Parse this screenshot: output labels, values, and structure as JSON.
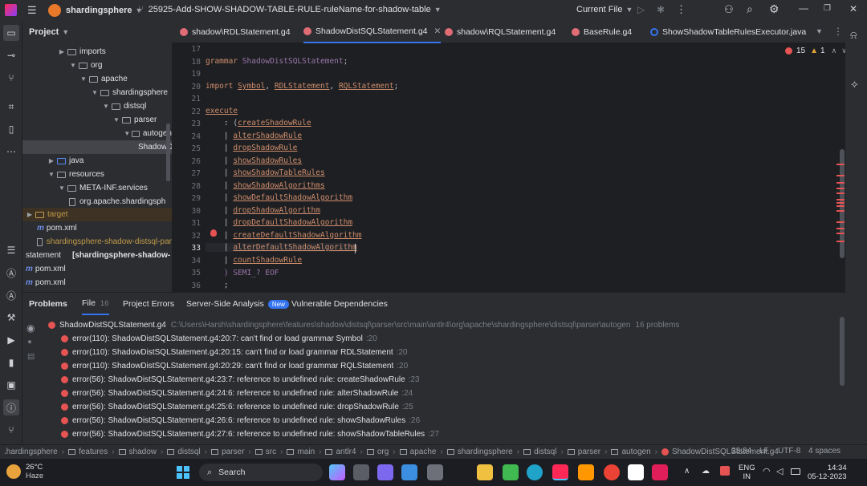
{
  "titlebar": {
    "project": "shardingsphere",
    "branch": "25925-Add-SHOW-SHADOW-TABLE-RULE-ruleName-for-shadow-table",
    "run_config": "Current File"
  },
  "project_panel": {
    "title": "Project",
    "tree": [
      {
        "label": "imports",
        "kind": "folder"
      },
      {
        "label": "org",
        "kind": "folder"
      },
      {
        "label": "apache",
        "kind": "folder"
      },
      {
        "label": "shardingsphere",
        "kind": "folder"
      },
      {
        "label": "distsql",
        "kind": "folder"
      },
      {
        "label": "parser",
        "kind": "folder"
      },
      {
        "label": "autogen",
        "kind": "folder"
      },
      {
        "label": "ShadowD",
        "kind": "file"
      },
      {
        "label": "java",
        "kind": "folder"
      },
      {
        "label": "resources",
        "kind": "folder"
      },
      {
        "label": "META-INF.services",
        "kind": "folder"
      },
      {
        "label": "org.apache.shardingsph",
        "kind": "file"
      },
      {
        "label": "target",
        "kind": "folder"
      },
      {
        "label": "pom.xml",
        "kind": "file"
      },
      {
        "label": "shardingsphere-shadow-distsql-par",
        "kind": "file"
      },
      {
        "label": "statement",
        "kind": "module"
      },
      {
        "label": "[shardingsphere-shadow-",
        "kind": "module"
      },
      {
        "label": "pom.xml",
        "kind": "file"
      },
      {
        "label": "pom.xml",
        "kind": "file"
      }
    ]
  },
  "tabs": [
    {
      "label": "shadow\\RDLStatement.g4",
      "active": false
    },
    {
      "label": "ShadowDistSQLStatement.g4",
      "active": true
    },
    {
      "label": "shadow\\RQLStatement.g4",
      "active": false
    },
    {
      "label": "BaseRule.g4",
      "active": false
    },
    {
      "label": "ShowShadowTableRulesExecutor.java",
      "active": false
    }
  ],
  "editor": {
    "error_count": "15",
    "warning_count": "1",
    "line_numbers": [
      "17",
      "18",
      "19",
      "20",
      "21",
      "22",
      "23",
      "24",
      "25",
      "26",
      "27",
      "28",
      "29",
      "30",
      "31",
      "32",
      "33",
      "34",
      "35",
      "36"
    ],
    "grammar_kw": "grammar",
    "grammar_name": "ShadowDistSQLStatement",
    "import_kw": "import",
    "imports": [
      "Symbol",
      "RDLStatement",
      "RQLStatement"
    ],
    "execute_kw": "execute",
    "rules": [
      "createShadowRule",
      "alterShadowRule",
      "dropShadowRule",
      "showShadowRules",
      "showShadowTableRules",
      "showShadowAlgorithms",
      "showDefaultShadowAlgorithm",
      "dropShadowAlgorithm",
      "dropDefaultShadowAlgorithm",
      "createDefaultShadowAlgorithm",
      "alterDefaultShadowAlgorithm",
      "countShadowRule"
    ],
    "end_line": ") SEMI_? EOF",
    "last_line": ";"
  },
  "problems": {
    "tabs": [
      {
        "label": "Problems"
      },
      {
        "label": "File",
        "count": "16"
      },
      {
        "label": "Project Errors"
      },
      {
        "label": "Server-Side Analysis",
        "badge": "New"
      },
      {
        "label": "Vulnerable Dependencies"
      }
    ],
    "file": "ShadowDistSQLStatement.g4",
    "path": "C:\\Users\\Harsh\\shardingsphere\\features\\shadow\\distsql\\parser\\src\\main\\antlr4\\org\\apache\\shardingsphere\\distsql\\parser\\autogen",
    "count_text": "16 problems",
    "items": [
      {
        "text": "error(110): ShadowDistSQLStatement.g4:20:7: can't find or load grammar Symbol",
        "line": ":20"
      },
      {
        "text": "error(110): ShadowDistSQLStatement.g4:20:15: can't find or load grammar RDLStatement",
        "line": ":20"
      },
      {
        "text": "error(110): ShadowDistSQLStatement.g4:20:29: can't find or load grammar RQLStatement",
        "line": ":20"
      },
      {
        "text": "error(56): ShadowDistSQLStatement.g4:23:7: reference to undefined rule: createShadowRule",
        "line": ":23"
      },
      {
        "text": "error(56): ShadowDistSQLStatement.g4:24:6: reference to undefined rule: alterShadowRule",
        "line": ":24"
      },
      {
        "text": "error(56): ShadowDistSQLStatement.g4:25:6: reference to undefined rule: dropShadowRule",
        "line": ":25"
      },
      {
        "text": "error(56): ShadowDistSQLStatement.g4:26:6: reference to undefined rule: showShadowRules",
        "line": ":26"
      },
      {
        "text": "error(56): ShadowDistSQLStatement.g4:27:6: reference to undefined rule: showShadowTableRules",
        "line": ":27"
      }
    ]
  },
  "statusbar": {
    "crumbs": [
      ".hardingsphere",
      "features",
      "shadow",
      "distsql",
      "parser",
      "src",
      "main",
      "antlr4",
      "org",
      "apache",
      "shardingsphere",
      "distsql",
      "parser",
      "autogen",
      "ShadowDistSQLStatement.g4"
    ],
    "position": "33:34",
    "line_sep": "LF",
    "encoding": "UTF-8",
    "indent": "4 spaces"
  },
  "taskbar": {
    "temperature": "26°C",
    "weather": "Haze",
    "search": "Search",
    "lang1": "ENG",
    "lang2": "IN",
    "time": "14:34",
    "date": "05-12-2023"
  },
  "colors": {
    "error": "#e55353",
    "accent": "#3574f0",
    "keyword": "#cf8e6d"
  }
}
